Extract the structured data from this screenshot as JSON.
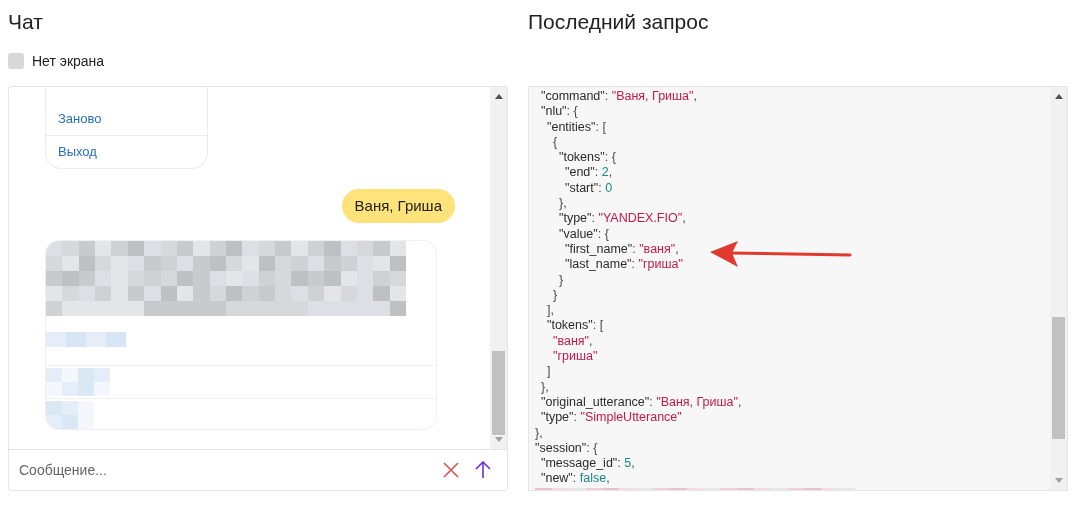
{
  "chat": {
    "title": "Чат",
    "no_screen": {
      "label": "Нет экрана",
      "checked": false
    },
    "buttons": [
      {
        "label": "Заново"
      },
      {
        "label": "Выход"
      }
    ],
    "user_message": "Ваня, Гриша",
    "input": {
      "placeholder": "Сообщение..."
    }
  },
  "request": {
    "title": "Последний запрос",
    "lines": [
      {
        "children": [
          {
            "tokens": [
              {
                "kind": "key",
                "text": "\"command\""
              },
              {
                "kind": "punct",
                "text": ": "
              },
              {
                "kind": "string",
                "text": "\"Ваня, Гриша\""
              },
              {
                "kind": "punct",
                "text": ","
              }
            ]
          },
          {
            "tokens": [
              {
                "kind": "key",
                "text": "\"nlu\""
              },
              {
                "kind": "punct",
                "text": ": {"
              }
            ],
            "children": [
              {
                "tokens": [
                  {
                    "kind": "key",
                    "text": "\"entities\""
                  },
                  {
                    "kind": "punct",
                    "text": ": ["
                  }
                ],
                "children": [
                  {
                    "tokens": [
                      {
                        "kind": "punct",
                        "text": "{"
                      }
                    ],
                    "children": [
                      {
                        "tokens": [
                          {
                            "kind": "key",
                            "text": "\"tokens\""
                          },
                          {
                            "kind": "punct",
                            "text": ": {"
                          }
                        ],
                        "children": [
                          {
                            "tokens": [
                              {
                                "kind": "key",
                                "text": "\"end\""
                              },
                              {
                                "kind": "punct",
                                "text": ": "
                              },
                              {
                                "kind": "number",
                                "text": "2"
                              },
                              {
                                "kind": "punct",
                                "text": ","
                              }
                            ]
                          },
                          {
                            "tokens": [
                              {
                                "kind": "key",
                                "text": "\"start\""
                              },
                              {
                                "kind": "punct",
                                "text": ": "
                              },
                              {
                                "kind": "number",
                                "text": "0"
                              }
                            ]
                          }
                        ]
                      },
                      {
                        "tokens": [
                          {
                            "kind": "punct",
                            "text": "},"
                          }
                        ]
                      },
                      {
                        "tokens": [
                          {
                            "kind": "key",
                            "text": "\"type\""
                          },
                          {
                            "kind": "punct",
                            "text": ": "
                          },
                          {
                            "kind": "string",
                            "text": "\"YANDEX.FIO\""
                          },
                          {
                            "kind": "punct",
                            "text": ","
                          }
                        ]
                      },
                      {
                        "tokens": [
                          {
                            "kind": "key",
                            "text": "\"value\""
                          },
                          {
                            "kind": "punct",
                            "text": ": {"
                          }
                        ],
                        "children": [
                          {
                            "tokens": [
                              {
                                "kind": "key",
                                "text": "\"first_name\""
                              },
                              {
                                "kind": "punct",
                                "text": ": "
                              },
                              {
                                "kind": "string",
                                "text": "\"ваня\""
                              },
                              {
                                "kind": "punct",
                                "text": ","
                              }
                            ]
                          },
                          {
                            "tokens": [
                              {
                                "kind": "key",
                                "text": "\"last_name\""
                              },
                              {
                                "kind": "punct",
                                "text": ": "
                              },
                              {
                                "kind": "string",
                                "text": "\"гриша\""
                              }
                            ]
                          }
                        ]
                      },
                      {
                        "tokens": [
                          {
                            "kind": "punct",
                            "text": "}"
                          }
                        ]
                      }
                    ]
                  },
                  {
                    "tokens": [
                      {
                        "kind": "punct",
                        "text": "}"
                      }
                    ]
                  }
                ]
              },
              {
                "tokens": [
                  {
                    "kind": "punct",
                    "text": "],"
                  }
                ]
              },
              {
                "tokens": [
                  {
                    "kind": "key",
                    "text": "\"tokens\""
                  },
                  {
                    "kind": "punct",
                    "text": ": ["
                  }
                ],
                "children": [
                  {
                    "tokens": [
                      {
                        "kind": "string",
                        "text": "\"ваня\""
                      },
                      {
                        "kind": "punct",
                        "text": ","
                      }
                    ]
                  },
                  {
                    "tokens": [
                      {
                        "kind": "string",
                        "text": "\"гриша\""
                      }
                    ]
                  }
                ]
              },
              {
                "tokens": [
                  {
                    "kind": "punct",
                    "text": "]"
                  }
                ]
              }
            ]
          },
          {
            "tokens": [
              {
                "kind": "punct",
                "text": "},"
              }
            ]
          },
          {
            "tokens": [
              {
                "kind": "key",
                "text": "\"original_utterance\""
              },
              {
                "kind": "punct",
                "text": ": "
              },
              {
                "kind": "string",
                "text": "\"Ваня, Гриша\""
              },
              {
                "kind": "punct",
                "text": ","
              }
            ]
          },
          {
            "tokens": [
              {
                "kind": "key",
                "text": "\"type\""
              },
              {
                "kind": "punct",
                "text": ": "
              },
              {
                "kind": "string",
                "text": "\"SimpleUtterance\""
              }
            ]
          }
        ]
      },
      {
        "tokens": [
          {
            "kind": "punct",
            "text": "},"
          }
        ]
      },
      {
        "tokens": [
          {
            "kind": "key",
            "text": "\"session\""
          },
          {
            "kind": "punct",
            "text": ": {"
          }
        ],
        "children": [
          {
            "tokens": [
              {
                "kind": "key",
                "text": "\"message_id\""
              },
              {
                "kind": "punct",
                "text": ": "
              },
              {
                "kind": "number",
                "text": "5"
              },
              {
                "kind": "punct",
                "text": ","
              }
            ]
          },
          {
            "tokens": [
              {
                "kind": "key",
                "text": "\"new\""
              },
              {
                "kind": "punct",
                "text": ": "
              },
              {
                "kind": "number",
                "text": "false"
              },
              {
                "kind": "punct",
                "text": ","
              }
            ]
          }
        ]
      }
    ]
  }
}
